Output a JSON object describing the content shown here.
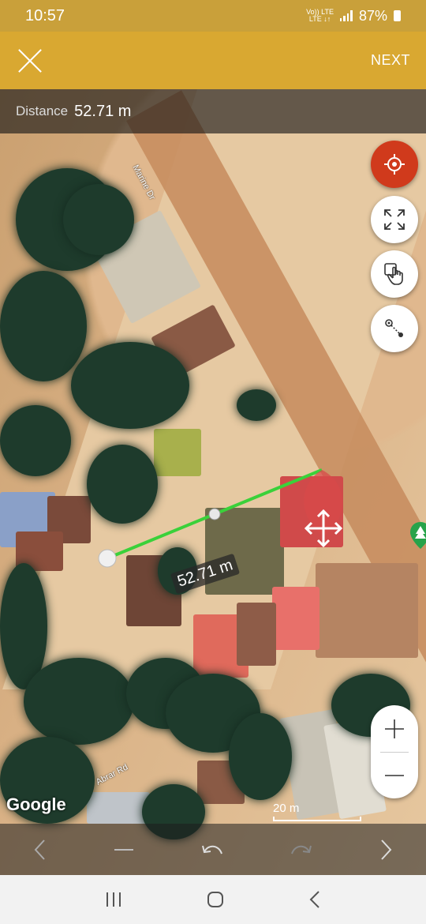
{
  "status_bar": {
    "time": "10:57",
    "network_top": "Vo)) LTE",
    "network_bottom": "LTE ↓↑",
    "battery": "87%"
  },
  "app_bar": {
    "close_icon": "close-icon",
    "next_label": "NEXT"
  },
  "distance_bar": {
    "label": "Distance",
    "value": "52.71 m"
  },
  "map": {
    "measure_label": "52.71 m",
    "streets": [
      "Marine Dr",
      "Abrar Rd"
    ],
    "attribution": "Google",
    "scale_label": "20 m",
    "line_color": "#3ad13a",
    "handle_color": "#d84a4a"
  },
  "fab_buttons": [
    {
      "name": "my-location-button",
      "icon": "crosshair-icon"
    },
    {
      "name": "fullscreen-button",
      "icon": "expand-icon"
    },
    {
      "name": "touch-mode-button",
      "icon": "hand-pointer-icon"
    },
    {
      "name": "point-to-point-button",
      "icon": "measure-points-icon"
    }
  ],
  "zoom": {
    "in": "+",
    "out": "—"
  },
  "bottom_tools": [
    "back-icon",
    "minus-icon",
    "undo-icon",
    "redo-icon",
    "forward-icon"
  ],
  "nav_bar": [
    "recent-apps-icon",
    "home-icon",
    "back-icon"
  ],
  "colors": {
    "app_bar": "#d9a831",
    "status_bar": "#c9a03a",
    "location_fab": "#d03a1c"
  }
}
